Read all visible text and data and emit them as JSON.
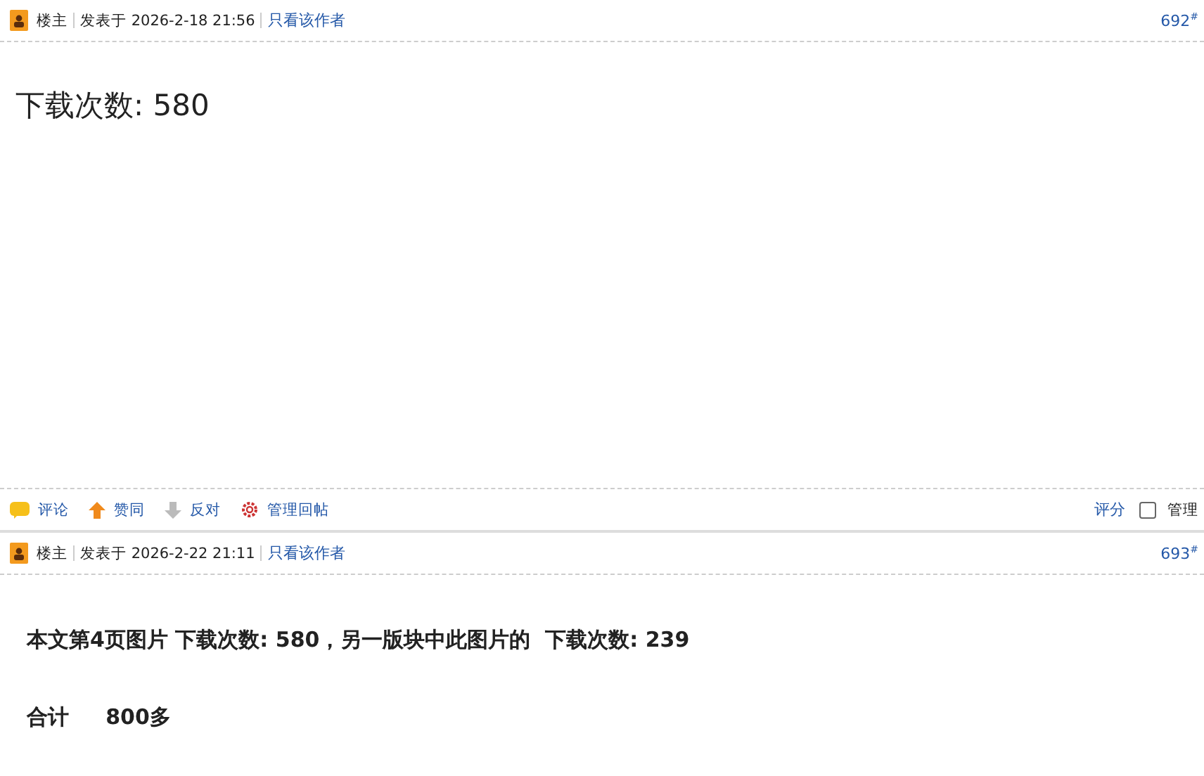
{
  "posts": [
    {
      "author": "楼主",
      "posted": "发表于 2026-2-18 21:56",
      "author_only": "只看该作者",
      "floor": "692$^{#}$",
      "content": [
        {
          "text": "下载次数: 580",
          "kind": "large"
        }
      ],
      "actions": [
        {
          "kind": "comment",
          "label": "评论"
        },
        {
          "kind": "up",
          "label": "赞同"
        },
        {
          "kind": "down",
          "label": "反对"
        },
        {
          "kind": "manage",
          "label": "管理回帖"
        }
      ],
      "rate": "评分",
      "manage": {
        "label": "管理",
        "checked": false
      }
    },
    {
      "author": "楼主",
      "posted": "发表于 2026-2-22 21:11",
      "author_only": "只看该作者",
      "floor": "693$^{#}$",
      "content": [
        {
          "text": "本文第4页图片 下载次数: 580，另一版块中此图片的  下载次数: 239",
          "kind": "bold"
        },
        {
          "text": "合计     800多",
          "kind": "bold"
        }
      ]
    }
  ]
}
